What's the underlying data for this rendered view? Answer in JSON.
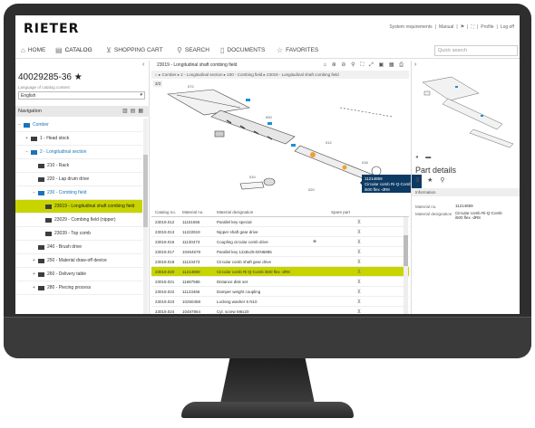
{
  "brand": {
    "logo": "RIETER"
  },
  "top_links": [
    "System requirements",
    "|",
    "Manual",
    "|",
    "⚑",
    "|",
    "⛶",
    "|",
    "Profile",
    "|",
    "Log off"
  ],
  "nav": {
    "home": "HOME",
    "catalog": "CATALOG",
    "cart": "SHOPPING CART",
    "search": "SEARCH",
    "documents": "DOCUMENTS",
    "favorites": "FAVORITES",
    "quick_search_placeholder": "Quick search"
  },
  "left": {
    "part_number": "40029285-36 ★",
    "language_label": "Language of catalog content",
    "language_value": "English",
    "navigation_label": "Navigation",
    "tree": [
      {
        "label": "Comber",
        "indent": 0,
        "toggle": "−",
        "folder": "blue",
        "state": "link"
      },
      {
        "label": "1 - Head stock",
        "indent": 1,
        "toggle": "+",
        "folder": "dark",
        "state": ""
      },
      {
        "label": "2 - Longitudinal section",
        "indent": 1,
        "toggle": "−",
        "folder": "blue",
        "state": "link"
      },
      {
        "label": "210 - Rack",
        "indent": 2,
        "toggle": "",
        "folder": "dark",
        "state": ""
      },
      {
        "label": "220 - Lap drum drive",
        "indent": 2,
        "toggle": "",
        "folder": "dark",
        "state": ""
      },
      {
        "label": "230 - Combing field",
        "indent": 2,
        "toggle": "−",
        "folder": "blue",
        "state": "link"
      },
      {
        "label": "23019 - Longitudinal shaft combing field",
        "indent": 3,
        "toggle": "",
        "folder": "dark",
        "state": "sel"
      },
      {
        "label": "23029 - Combing field (nipper)",
        "indent": 3,
        "toggle": "",
        "folder": "dark",
        "state": ""
      },
      {
        "label": "23039 - Top comb",
        "indent": 3,
        "toggle": "",
        "folder": "dark",
        "state": ""
      },
      {
        "label": "240 - Brush drive",
        "indent": 2,
        "toggle": "",
        "folder": "dark",
        "state": ""
      },
      {
        "label": "250 - Material draw-off device",
        "indent": 2,
        "toggle": "+",
        "folder": "dark",
        "state": ""
      },
      {
        "label": "260 - Delivery table",
        "indent": 2,
        "toggle": "+",
        "folder": "dark",
        "state": ""
      },
      {
        "label": "280 - Piecing process",
        "indent": 2,
        "toggle": "+",
        "folder": "dark",
        "state": ""
      }
    ]
  },
  "center": {
    "title": "23019 - Longitudinal shaft combing field",
    "breadcrumb": "⌂ ▸ Comber ▸ 2 - Longitudinal section ▸ 230 - Combing field ▸ 23019 - Longitudinal shaft combing field",
    "page_no": "3/3",
    "tooltip_line1": "11214859",
    "tooltip_line2": "Circular comb Ri-Q-Comb i500 flex -dR8",
    "columns": [
      "Catalog no.",
      "Material no.",
      "Material designation",
      "",
      "Spare part",
      ""
    ],
    "rows": [
      {
        "cat": "23019.012",
        "mat": "11151666",
        "desc": "Parallel key special",
        "sp": "",
        "sel": false
      },
      {
        "cat": "23019.013",
        "mat": "11222819",
        "desc": "Nipper shaft gear drive",
        "sp": "",
        "sel": false
      },
      {
        "cat": "23019.016",
        "mat": "11130473",
        "desc": "Coupling circular comb drive",
        "sp": "⊕",
        "sel": false
      },
      {
        "cat": "23019.017",
        "mat": "10464578",
        "desc": "Parallel key 12x8x25-DIN6885",
        "sp": "",
        "sel": false
      },
      {
        "cat": "23019.018",
        "mat": "11123473",
        "desc": "Circular comb shaft gear drive",
        "sp": "",
        "sel": false
      },
      {
        "cat": "23019.020",
        "mat": "11214859",
        "desc": "Circular comb Ri-Q-Comb i500 flex -dR8",
        "sp": "",
        "sel": true
      },
      {
        "cat": "23019.021",
        "mat": "11687586",
        "desc": "Distance disk set",
        "sp": "",
        "sel": false
      },
      {
        "cat": "23019.022",
        "mat": "11123466",
        "desc": "Damper weight coupling",
        "sp": "",
        "sel": false
      },
      {
        "cat": "23019.023",
        "mat": "10250458",
        "desc": "Locking washer 6 N10",
        "sp": "",
        "sel": false
      },
      {
        "cat": "23019.024",
        "mat": "10487864",
        "desc": "Cyl. screw M6x20",
        "sp": "",
        "sel": false
      }
    ]
  },
  "right": {
    "panel_title": "Part details",
    "info_label": "Information",
    "details": [
      {
        "k": "Material no.",
        "v": "11214859"
      },
      {
        "k": "Material designation",
        "v": "Circular comb Ri-Q-Comb i500 flex -dR8"
      }
    ]
  }
}
